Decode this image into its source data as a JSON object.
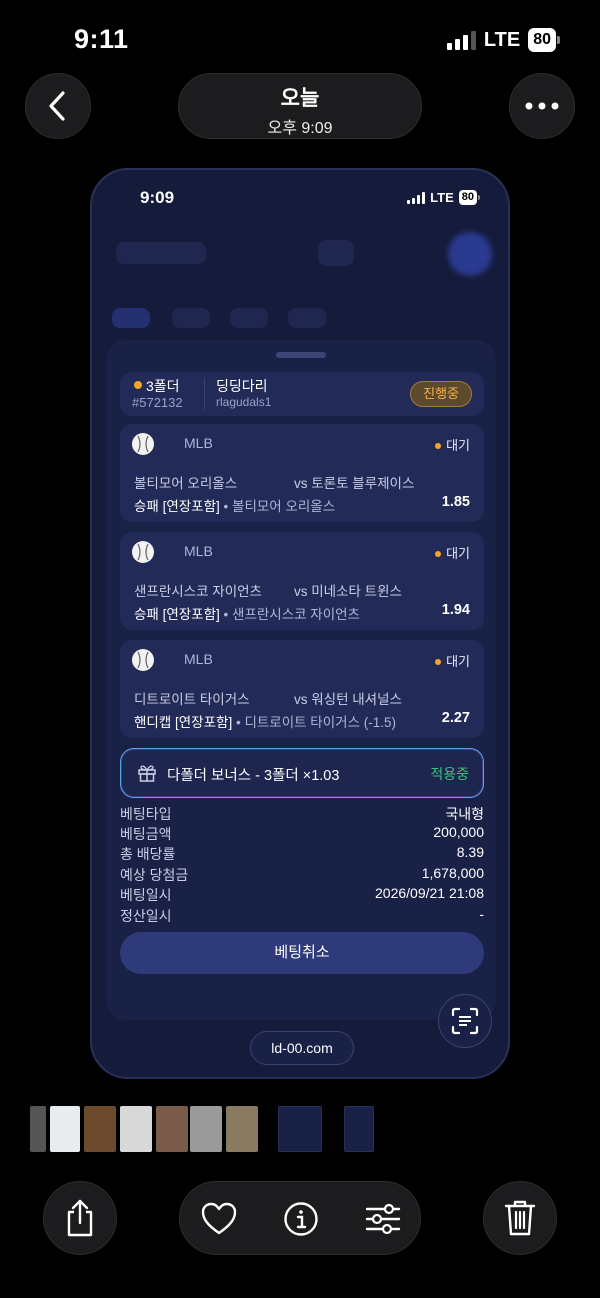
{
  "status_bar": {
    "time": "9:11",
    "network": "LTE",
    "battery": "80"
  },
  "header": {
    "title": "오늘",
    "subtitle": "오후 9:09"
  },
  "screenshot": {
    "status_bar": {
      "time": "9:09",
      "network": "LTE",
      "battery": "80"
    },
    "folder": {
      "type_label": "3폴더",
      "bet_id": "#572132",
      "name": "딩딩다리",
      "user": "rlagudals1",
      "status": "진행중"
    },
    "bets": [
      {
        "league": "MLB",
        "status": "대기",
        "home": "볼티모어 오리올스",
        "away": "vs 토론토 블루제이스",
        "market": "승패 [연장포함]",
        "selection": "• 볼티모어 오리올스",
        "odds": "1.85"
      },
      {
        "league": "MLB",
        "status": "대기",
        "home": "샌프란시스코 자이언츠",
        "away": "vs 미네소타 트윈스",
        "market": "승패 [연장포함]",
        "selection": "• 샌프란시스코 자이언츠",
        "odds": "1.94"
      },
      {
        "league": "MLB",
        "status": "대기",
        "home": "디트로이트 타이거스",
        "away": "vs 워싱턴 내셔널스",
        "market": "핸디캡 [연장포함]",
        "selection": "• 디트로이트 타이거스 (-1.5)",
        "odds": "2.27"
      }
    ],
    "bonus": {
      "label": "다폴더 보너스 - 3폴더 ×1.03",
      "status": "적용중"
    },
    "details": [
      {
        "label": "베팅타입",
        "value": "국내형"
      },
      {
        "label": "베팅금액",
        "value": "200,000"
      },
      {
        "label": "총 배당률",
        "value": "8.39"
      },
      {
        "label": "예상 당첨금",
        "value": "1,678,000"
      },
      {
        "label": "베팅일시",
        "value": "2026/09/21 21:08"
      },
      {
        "label": "정산일시",
        "value": "-"
      }
    ],
    "cancel_label": "베팅취소",
    "url": "ld-00.com"
  },
  "icons": {
    "back": "chevron-left-icon",
    "more": "ellipsis-icon",
    "share": "share-icon",
    "favorite": "heart-icon",
    "info": "info-icon",
    "adjust": "sliders-icon",
    "delete": "trash-icon"
  },
  "colors": {
    "background": "#000000",
    "phone_bg": "#151b3a",
    "card_bg": "#222b57",
    "accent_orange": "#f5a623",
    "bonus_green": "#36c47a"
  }
}
